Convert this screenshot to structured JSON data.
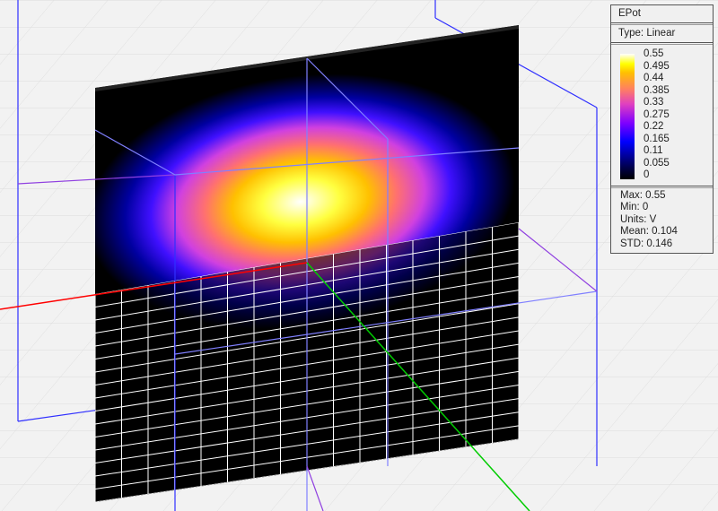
{
  "legend": {
    "title": "EPot",
    "type": "Type: Linear",
    "ticks": [
      "0.55",
      "0.495",
      "0.44",
      "0.385",
      "0.33",
      "0.275",
      "0.22",
      "0.165",
      "0.11",
      "0.055",
      "0"
    ],
    "stats": [
      "Max: 0.55",
      "Min: 0",
      "Units: V",
      "Mean: 0.104",
      "STD: 0.146"
    ]
  },
  "colors": {
    "axis_x": "#ff0000",
    "axis_y": "#00cc00",
    "box": "#3030ff",
    "box2": "#9040e0"
  }
}
